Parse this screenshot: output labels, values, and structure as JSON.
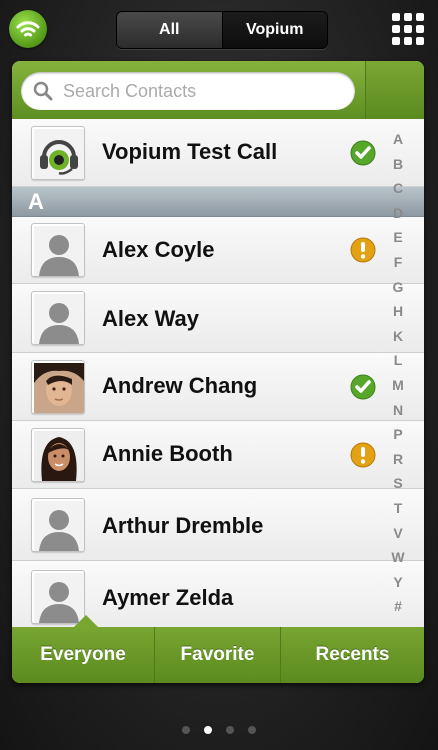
{
  "topbar": {
    "tabs": [
      {
        "label": "All",
        "active": true
      },
      {
        "label": "Vopium",
        "active": false
      }
    ],
    "logo_icon": "wifi-logo-icon",
    "menu_icon": "grid-menu-icon"
  },
  "search": {
    "placeholder": "Search Contacts",
    "value": ""
  },
  "contacts": {
    "pinned": {
      "name": "Vopium Test Call",
      "status": "check"
    },
    "section_header": "A",
    "items": [
      {
        "name": "Alex Coyle",
        "status": "warning",
        "photo": "placeholder"
      },
      {
        "name": "Alex Way",
        "status": "",
        "photo": "placeholder"
      },
      {
        "name": "Andrew Chang",
        "status": "check",
        "photo": "male-photo"
      },
      {
        "name": "Annie Booth",
        "status": "warning",
        "photo": "female-photo"
      },
      {
        "name": "Arthur Dremble",
        "status": "",
        "photo": "placeholder"
      },
      {
        "name": "Aymer Zelda",
        "status": "",
        "photo": "placeholder"
      }
    ]
  },
  "index_letters": [
    "A",
    "B",
    "C",
    "D",
    "E",
    "F",
    "G",
    "H",
    "K",
    "L",
    "M",
    "N",
    "P",
    "R",
    "S",
    "T",
    "V",
    "W",
    "Y",
    "#"
  ],
  "bottom_tabs": [
    {
      "label": "Everyone",
      "active": true
    },
    {
      "label": "Favorite",
      "active": false
    },
    {
      "label": "Recents",
      "active": false
    }
  ],
  "page_indicator": {
    "count": 4,
    "active_index": 1
  },
  "colors": {
    "accent_green": "#6b9a28",
    "check_green": "#57a82a",
    "warning_orange": "#e3a114"
  }
}
